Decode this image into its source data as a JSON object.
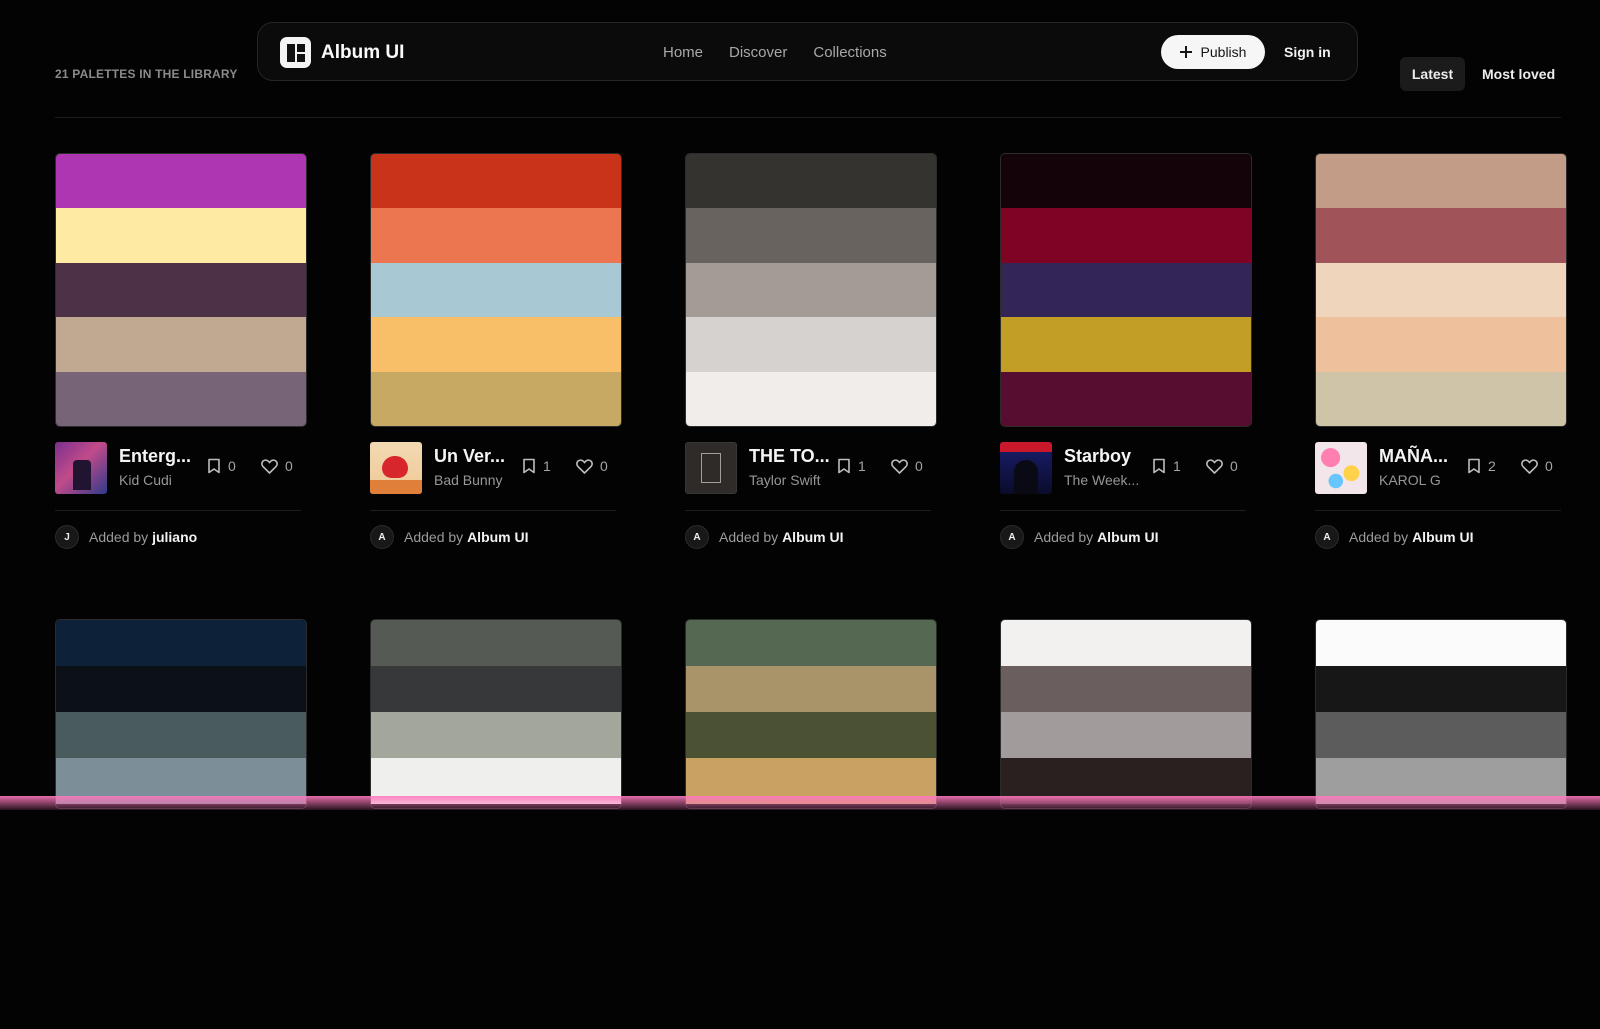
{
  "library_count": "21 PALETTES IN THE LIBRARY",
  "app_title": "Album UI",
  "nav": [
    "Home",
    "Discover",
    "Collections"
  ],
  "publish_label": "Publish",
  "signin_label": "Sign in",
  "sort": {
    "latest": "Latest",
    "loved": "Most loved"
  },
  "cards": [
    {
      "title": "Enterg...",
      "artist": "Kid Cudi",
      "saves": "0",
      "likes": "0",
      "added_by": "Added by",
      "added_name": "juliano",
      "avatar": "J",
      "colors": [
        "#ae36b2",
        "#ffeaa3",
        "#4d3147",
        "#c1a891",
        "#786477"
      ]
    },
    {
      "title": "Un Ver...",
      "artist": "Bad Bunny",
      "saves": "1",
      "likes": "0",
      "added_by": "Added by",
      "added_name": "Album UI",
      "avatar": "A",
      "colors": [
        "#c9331a",
        "#eb7650",
        "#a8c8d3",
        "#f8bf68",
        "#c7a964"
      ]
    },
    {
      "title": "THE TO...",
      "artist": "Taylor Swift",
      "saves": "1",
      "likes": "0",
      "added_by": "Added by",
      "added_name": "Album UI",
      "avatar": "A",
      "colors": [
        "#353330",
        "#68635e",
        "#a39b96",
        "#d6d2cf",
        "#f1edea"
      ]
    },
    {
      "title": "Starboy",
      "artist": "The Week...",
      "saves": "1",
      "likes": "0",
      "added_by": "Added by",
      "added_name": "Album UI",
      "avatar": "A",
      "colors": [
        "#14040a",
        "#7f0423",
        "#342557",
        "#c39e27",
        "#560d2f"
      ]
    },
    {
      "title": "MAÑA...",
      "artist": "KAROL G",
      "saves": "2",
      "likes": "0",
      "added_by": "Added by",
      "added_name": "Album UI",
      "avatar": "A",
      "colors": [
        "#c29c87",
        "#a0545a",
        "#efd5bb",
        "#eec19c",
        "#d0c4a8"
      ]
    }
  ],
  "row2": [
    {
      "colors": [
        "#0d2238",
        "#0b1117",
        "#4a5b5e",
        "#7c8f98"
      ]
    },
    {
      "colors": [
        "#565a54",
        "#373839",
        "#a3a69a",
        "#efefed"
      ]
    },
    {
      "colors": [
        "#546852",
        "#a89468",
        "#4b5233",
        "#c9a263"
      ]
    },
    {
      "colors": [
        "#f2f1f0",
        "#6b5e5e",
        "#a19b9c",
        "#2b2020"
      ]
    },
    {
      "colors": [
        "#fbfbfb",
        "#171717",
        "#5c5c5c",
        "#9e9e9e"
      ]
    }
  ]
}
